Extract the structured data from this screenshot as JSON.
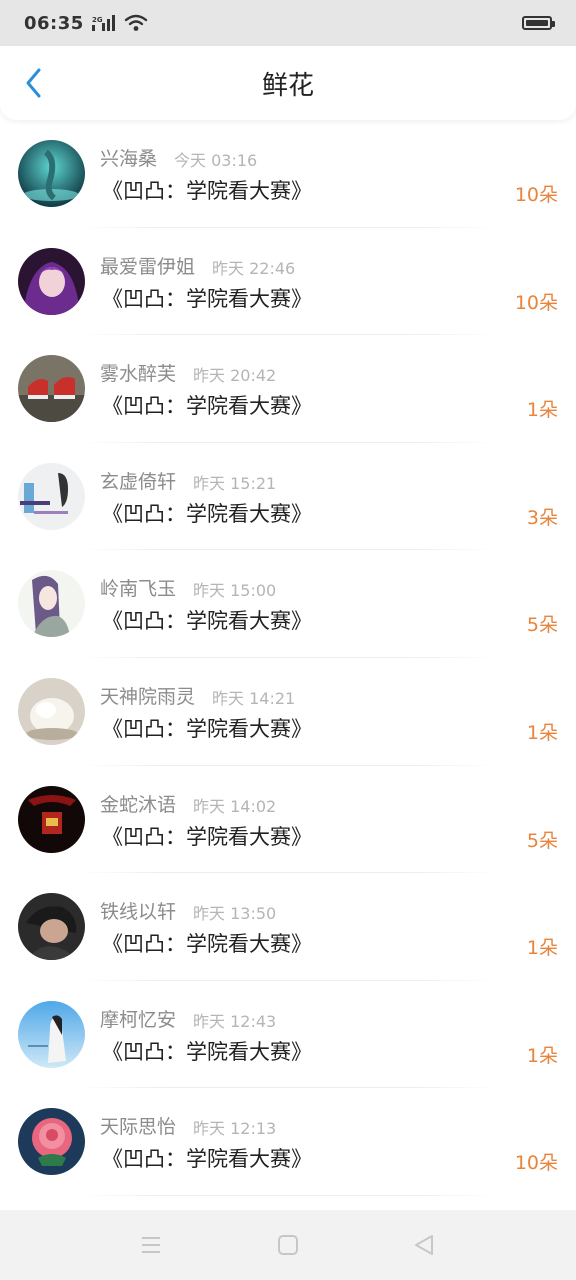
{
  "status": {
    "time": "06:35",
    "network": "2G"
  },
  "header": {
    "title": "鲜花"
  },
  "colors": {
    "accent": "#2a8fd8",
    "flower_count": "#e8843c",
    "name": "#8c8c8c"
  },
  "items": [
    {
      "name": "兴海桑",
      "time": "今天 03:16",
      "book": "《凹凸：学院看大赛》",
      "count": "10朵",
      "avatar": "teal-fantasy-avatar"
    },
    {
      "name": "最爱雷伊姐",
      "time": "昨天 22:46",
      "book": "《凹凸：学院看大赛》",
      "count": "10朵",
      "avatar": "purple-anime-avatar"
    },
    {
      "name": "雾水醉芙",
      "time": "昨天 20:42",
      "book": "《凹凸：学院看大赛》",
      "count": "1朵",
      "avatar": "red-sneakers-avatar"
    },
    {
      "name": "玄虚倚轩",
      "time": "昨天 15:21",
      "book": "《凹凸：学院看大赛》",
      "count": "3朵",
      "avatar": "text-photo-avatar"
    },
    {
      "name": "岭南飞玉",
      "time": "昨天 15:00",
      "book": "《凹凸：学院看大赛》",
      "count": "5朵",
      "avatar": "anime-girl-avatar"
    },
    {
      "name": "天神院雨灵",
      "time": "昨天 14:21",
      "book": "《凹凸：学院看大赛》",
      "count": "1朵",
      "avatar": "white-sweet-avatar"
    },
    {
      "name": "金蛇沐语",
      "time": "昨天 14:02",
      "book": "《凹凸：学院看大赛》",
      "count": "5朵",
      "avatar": "dark-red-avatar"
    },
    {
      "name": "铁线以轩",
      "time": "昨天 13:50",
      "book": "《凹凸：学院看大赛》",
      "count": "1朵",
      "avatar": "dark-portrait-avatar"
    },
    {
      "name": "摩柯忆安",
      "time": "昨天 12:43",
      "book": "《凹凸：学院看大赛》",
      "count": "1朵",
      "avatar": "sky-girl-avatar"
    },
    {
      "name": "天际思怡",
      "time": "昨天 12:13",
      "book": "《凹凸：学院看大赛》",
      "count": "10朵",
      "avatar": "pink-rose-avatar"
    }
  ]
}
